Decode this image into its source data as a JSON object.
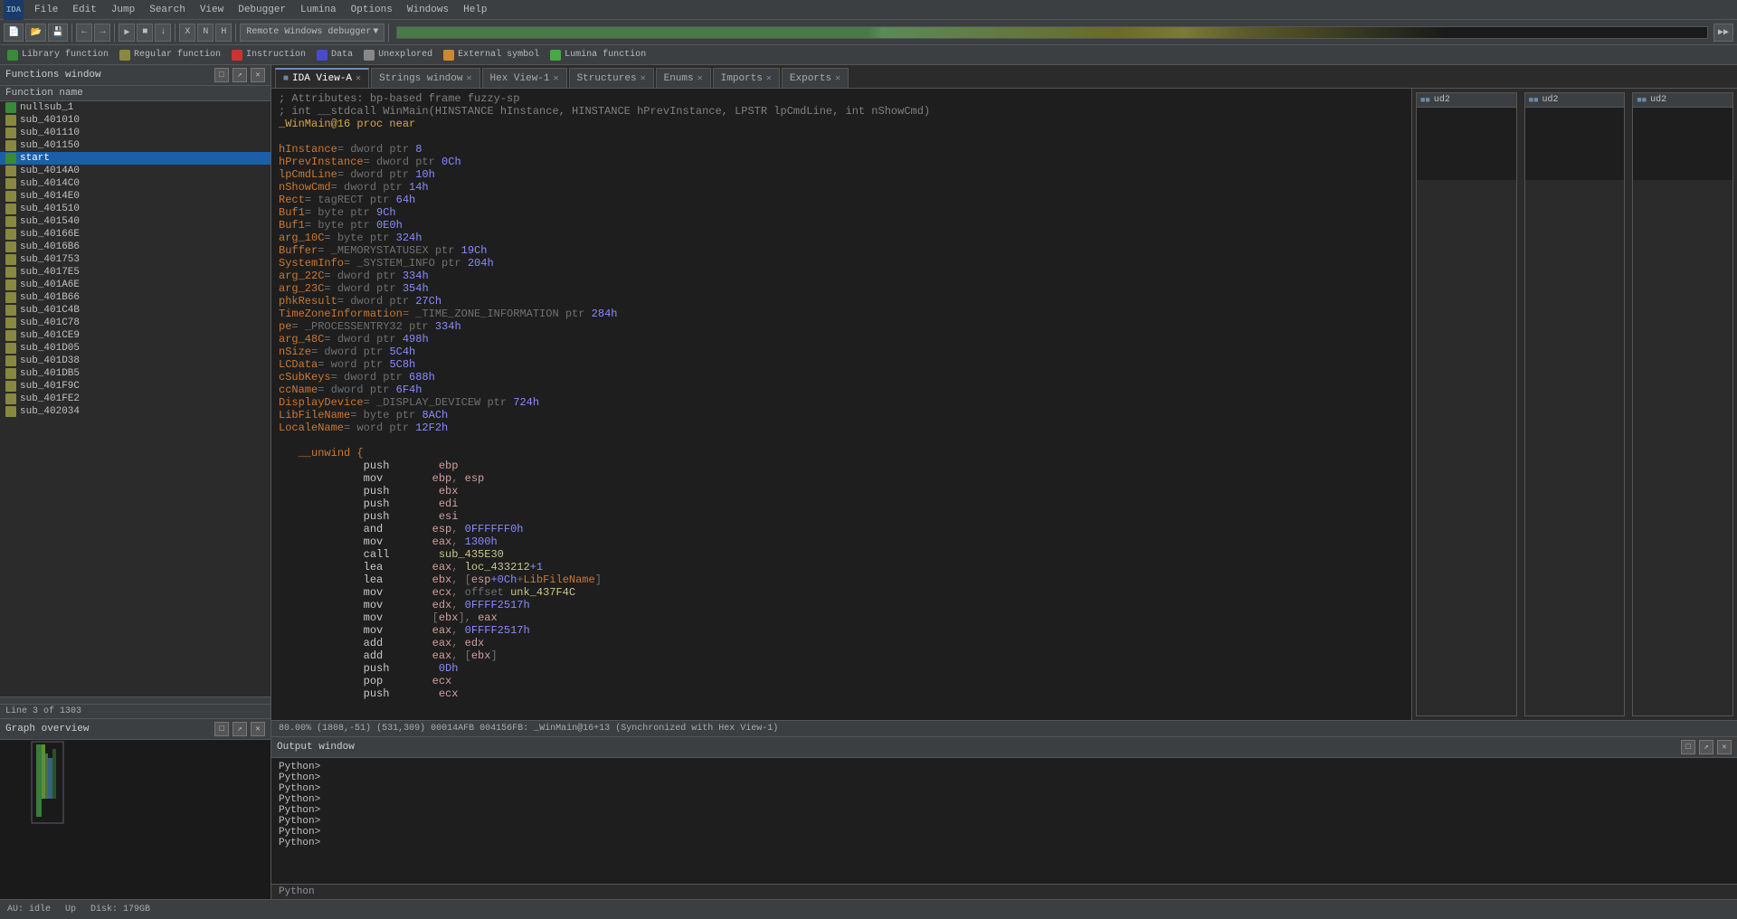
{
  "menubar": {
    "items": [
      "File",
      "Edit",
      "Jump",
      "Search",
      "View",
      "Debugger",
      "Lumina",
      "Options",
      "Windows",
      "Help"
    ]
  },
  "legend": {
    "items": [
      {
        "label": "Library function",
        "color": "#3a8a3a"
      },
      {
        "label": "Regular function",
        "color": "#8a8840"
      },
      {
        "label": "Instruction",
        "color": "#cc3333"
      },
      {
        "label": "Data",
        "color": "#4a4acc"
      },
      {
        "label": "Unexplored",
        "color": "#888888"
      },
      {
        "label": "External symbol",
        "color": "#cc8833"
      },
      {
        "label": "Lumina function",
        "color": "#44aa44"
      }
    ]
  },
  "tabs": [
    {
      "label": "IDA View-A",
      "active": true,
      "closeable": true
    },
    {
      "label": "Strings window",
      "active": false,
      "closeable": true
    },
    {
      "label": "Hex View-1",
      "active": false,
      "closeable": true
    },
    {
      "label": "Structures",
      "active": false,
      "closeable": true
    },
    {
      "label": "Enums",
      "active": false,
      "closeable": true
    },
    {
      "label": "Imports",
      "active": false,
      "closeable": true
    },
    {
      "label": "Exports",
      "active": false,
      "closeable": true
    }
  ],
  "functions_window": {
    "title": "Functions window",
    "column_header": "Function name",
    "items": [
      {
        "name": "nullsub_1",
        "type": "lib"
      },
      {
        "name": "sub_401010",
        "type": "reg"
      },
      {
        "name": "sub_401110",
        "type": "reg"
      },
      {
        "name": "sub_401150",
        "type": "reg"
      },
      {
        "name": "start",
        "type": "start",
        "selected": true
      },
      {
        "name": "sub_4014A0",
        "type": "reg"
      },
      {
        "name": "sub_4014C0",
        "type": "reg"
      },
      {
        "name": "sub_4014E0",
        "type": "reg"
      },
      {
        "name": "sub_401510",
        "type": "reg"
      },
      {
        "name": "sub_401540",
        "type": "reg"
      },
      {
        "name": "sub_40166E",
        "type": "reg"
      },
      {
        "name": "sub_4016B6",
        "type": "reg"
      },
      {
        "name": "sub_401753",
        "type": "reg"
      },
      {
        "name": "sub_4017E5",
        "type": "reg"
      },
      {
        "name": "sub_401A6E",
        "type": "reg"
      },
      {
        "name": "sub_401B66",
        "type": "reg"
      },
      {
        "name": "sub_401C4B",
        "type": "reg"
      },
      {
        "name": "sub_401C78",
        "type": "reg"
      },
      {
        "name": "sub_401CE9",
        "type": "reg"
      },
      {
        "name": "sub_401D05",
        "type": "reg"
      },
      {
        "name": "sub_401D38",
        "type": "reg"
      },
      {
        "name": "sub_401DB5",
        "type": "reg"
      },
      {
        "name": "sub_401F9C",
        "type": "reg"
      },
      {
        "name": "sub_401FE2",
        "type": "reg"
      },
      {
        "name": "sub_402034",
        "type": "reg"
      }
    ],
    "status": "Line 3 of 1303"
  },
  "graph_overview": {
    "title": "Graph overview"
  },
  "disasm": {
    "header_comment": "; Attributes: bp-based frame fuzzy-sp",
    "proc_decl": "; int __stdcall WinMain(HINSTANCE hInstance, HINSTANCE hPrevInstance, LPSTR lpCmdLine, int nShowCmd)",
    "proc_name": "_WinMain@16 proc near",
    "vars": [
      "hInstance= dword ptr  8",
      "hPrevInstance= dword ptr  0Ch",
      "lpCmdLine= dword ptr  10h",
      "nShowCmd= dword ptr  14h",
      "Rect= tagRECT ptr  64h",
      "Buf1= byte ptr  9Ch",
      "Buf1= byte ptr  0E0h",
      "arg_10C= byte ptr  324h",
      "Buffer= _MEMORYSTATUSEX ptr  19Ch",
      "SystemInfo= _SYSTEM_INFO ptr  204h",
      "arg_22C= dword ptr  334h",
      "arg_23C= dword ptr  354h",
      "phkResult= dword ptr  27Ch",
      "TimeZoneInformation= _TIME_ZONE_INFORMATION ptr  284h",
      "pe= _PROCESSENTRY32 ptr  334h",
      "arg_48C= dword ptr  498h",
      "nSize= dword ptr  5C4h",
      "LCData= word ptr  5C8h",
      "cSubKeys= dword ptr  688h",
      "ccName= dword ptr  6F4h",
      "DisplayDevice= _DISPLAY_DEVICEW ptr  724h",
      "LibFileName= byte ptr  8ACh",
      "LocaleName= word ptr  12F2h"
    ],
    "unwind": "  __unwind {",
    "instructions": [
      {
        "addr": "",
        "instr": "push",
        "op": "ebp"
      },
      {
        "addr": "",
        "instr": "mov",
        "op": "ebp, esp"
      },
      {
        "addr": "",
        "instr": "push",
        "op": "ebx"
      },
      {
        "addr": "",
        "instr": "push",
        "op": "edi"
      },
      {
        "addr": "",
        "instr": "push",
        "op": "esi"
      },
      {
        "addr": "",
        "instr": "and",
        "op": "esp, 0FFFFFF0h"
      },
      {
        "addr": "",
        "instr": "mov",
        "op": "eax, 1300h"
      },
      {
        "addr": "",
        "instr": "call",
        "op": "sub_435E30"
      },
      {
        "addr": "",
        "instr": "lea",
        "op": "eax, loc_433212+1"
      },
      {
        "addr": "",
        "instr": "lea",
        "op": "ebx, [esp+0Ch+LibFileName]"
      },
      {
        "addr": "",
        "instr": "mov",
        "op": "ecx, offset unk_437F4C"
      },
      {
        "addr": "",
        "instr": "mov",
        "op": "edx, 0FFFF2517h"
      },
      {
        "addr": "",
        "instr": "mov",
        "op": "[ebx], eax"
      },
      {
        "addr": "",
        "instr": "mov",
        "op": "eax, 0FFFF2517h"
      },
      {
        "addr": "",
        "instr": "add",
        "op": "eax, edx"
      },
      {
        "addr": "",
        "instr": "add",
        "op": "eax, [ebx]"
      },
      {
        "addr": "",
        "instr": "push",
        "op": "0Dh"
      },
      {
        "addr": "",
        "instr": "pop",
        "op": "ecx"
      },
      {
        "addr": "",
        "instr": "push",
        "op": "ecx"
      }
    ]
  },
  "statusbar": {
    "percent": "80.00%",
    "coords": "(1808,-51)",
    "addr1": "(531,309)",
    "addr2": "00014AFB",
    "addr3": "004156FB:",
    "label": "_WinMain@16+13",
    "sync": "(Synchronized with Hex View-1)"
  },
  "output_window": {
    "title": "Output window",
    "prompts": [
      "Python>",
      "Python>",
      "Python>",
      "Python>",
      "Python>",
      "Python>",
      "Python>",
      "Python>"
    ],
    "bottom_tab": "Python"
  },
  "ud2_panels": [
    {
      "title": "ud2"
    },
    {
      "title": "ud2"
    },
    {
      "title": "ud2"
    }
  ],
  "bottom_status": {
    "mode": "AU: idle",
    "state": "Up",
    "disk": "Disk: 179GB"
  },
  "search": {
    "label": "Search"
  }
}
